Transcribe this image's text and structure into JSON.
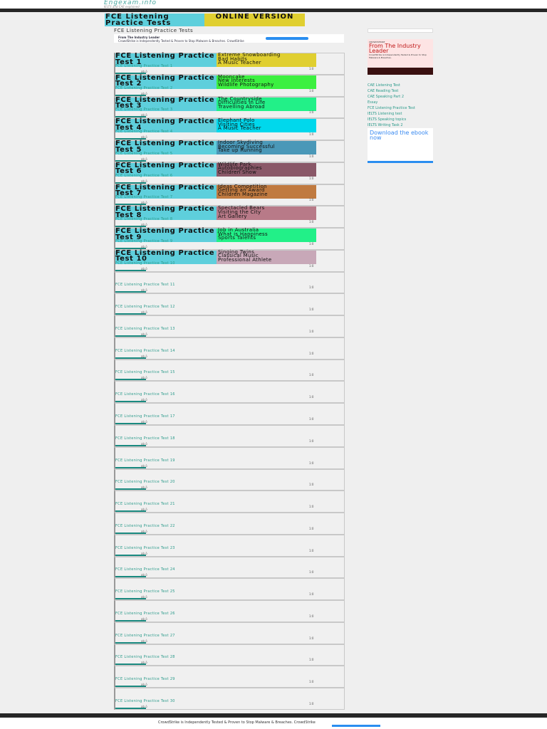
{
  "site": {
    "logo": "Engexam.info",
    "tagline": "IELTS and CAE explained"
  },
  "header": {
    "left": "FCE Listening Practice Tests",
    "right": "ONLINE VERSION"
  },
  "subtitle": "FCE Listening Practice Tests",
  "top_ad": {
    "title": "From The Industry Leader",
    "text": "CrowdStrike is Independently Tested & Proven to Stop Malware & Breaches. CrowdStrike"
  },
  "tests": [
    {
      "title": "FCE Listening Practice Test 1",
      "topics": [
        "Extreme Snowboarding",
        "Bad Habits",
        "A Music Teacher"
      ],
      "color": "#e0cf30"
    },
    {
      "title": "FCE Listening Practice Test 2",
      "topics": [
        "Mooncake",
        "New Interests",
        "Wildlife Photography"
      ],
      "color": "#3cf040"
    },
    {
      "title": "FCE Listening Practice Test 3",
      "topics": [
        "The Countryside",
        "Difficulties in Life",
        "Travelling Abroad"
      ],
      "color": "#22f088"
    },
    {
      "title": "FCE Listening Practice Test 4",
      "topics": [
        "Elephant Polo",
        "Visiting Cities",
        "A Music Teacher"
      ],
      "color": "#00d8ec"
    },
    {
      "title": "FCE Listening Practice Test 5",
      "topics": [
        "Indoor Skydiving",
        "Becoming Successful",
        "Take up Running"
      ],
      "color": "#4a98b8"
    },
    {
      "title": "FCE Listening Practice Test 6",
      "topics": [
        "Wildlife Park",
        "Autobiographies",
        "Children Show"
      ],
      "color": "#8a5868"
    },
    {
      "title": "FCE Listening Practice Test 7",
      "topics": [
        "Ideas Competition",
        "Getting an Award",
        "Children Magazine"
      ],
      "color": "#c07a40"
    },
    {
      "title": "FCE Listening Practice Test 8",
      "topics": [
        "Spectacled Bears",
        "Visiting the City",
        "Art Gallery"
      ],
      "color": "#b87a88"
    },
    {
      "title": "FCE Listening Practice Test 9",
      "topics": [
        "Job in Australia",
        "What is Happiness",
        "Sports Talents"
      ],
      "color": "#22f088"
    },
    {
      "title": "FCE Listening Practice Test 10",
      "topics": [
        "Singing Twins",
        "Classical Music",
        "Professional Athlete"
      ],
      "color": "#c8a8b8"
    }
  ],
  "player": {
    "time": "1:0",
    "controls": "ab ö"
  },
  "more_tests": [
    "FCE Listening Practice Test 11",
    "FCE Listening Practice Test 12",
    "FCE Listening Practice Test 13",
    "FCE Listening Practice Test 14",
    "FCE Listening Practice Test 15",
    "FCE Listening Practice Test 16",
    "FCE Listening Practice Test 17",
    "FCE Listening Practice Test 18",
    "FCE Listening Practice Test 19",
    "FCE Listening Practice Test 20",
    "FCE Listening Practice Test 21",
    "FCE Listening Practice Test 22",
    "FCE Listening Practice Test 23",
    "FCE Listening Practice Test 24",
    "FCE Listening Practice Test 25",
    "FCE Listening Practice Test 26",
    "FCE Listening Practice Test 27",
    "FCE Listening Practice Test 28",
    "FCE Listening Practice Test 29",
    "FCE Listening Practice Test 30"
  ],
  "sidebar": {
    "ad": {
      "brand": "CROWDSTRIKE",
      "headline": "From The Industry Leader",
      "text": "CrowdStrike is Independently Tested & Proven to Stop Malware & Breaches."
    },
    "links": [
      "CAE Listening Test",
      "CAE Reading Test",
      "CAE Speaking Part 2",
      "Essay",
      "FCE Listening Practice Test",
      "IELTS Listening test",
      "IELTS Speaking topics",
      "IELTS Writing Task 2"
    ],
    "ebook": "Download the ebook now"
  },
  "footer_ad": "CrowdStrike is Independently Tested & Proven to Stop Malware & Breaches. CrowdStrike"
}
